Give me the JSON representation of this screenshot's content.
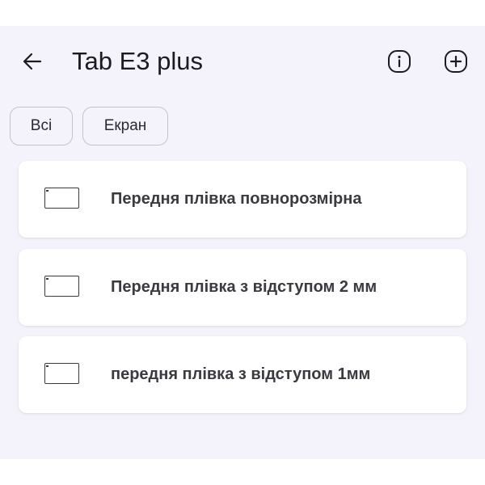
{
  "header": {
    "title": "Tab E3 plus",
    "back_icon": "arrow-back-icon",
    "info_icon": "info-icon",
    "add_icon": "add-circle-icon"
  },
  "filters": [
    {
      "label": "Всі"
    },
    {
      "label": "Екран"
    }
  ],
  "items": [
    {
      "label": "Передня плівка повнорозмірна",
      "icon": "tablet-outline-icon"
    },
    {
      "label": "Передня плівка з відступом 2 мм",
      "icon": "tablet-outline-icon"
    },
    {
      "label": "передня плівка з відступом 1мм",
      "icon": "tablet-outline-icon"
    }
  ],
  "colors": {
    "background": "#f4f2fa",
    "card": "#ffffff",
    "text": "#1c1b1f",
    "chip_border": "#c4c2cc"
  }
}
